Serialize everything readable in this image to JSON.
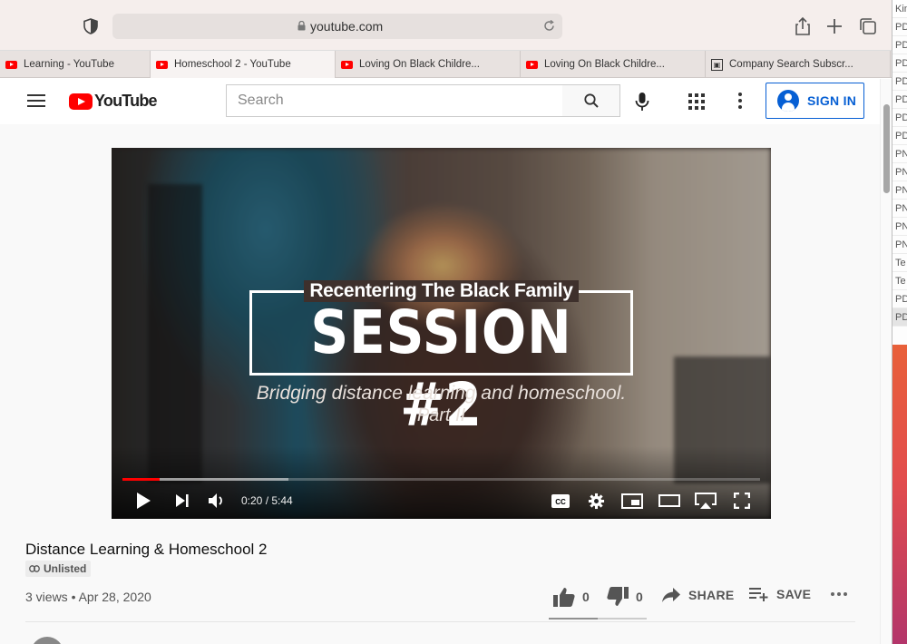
{
  "browser": {
    "url": "youtube.com",
    "tabs": [
      {
        "label": "Learning - YouTube",
        "favicon": "youtube-icon",
        "active": false
      },
      {
        "label": "Homeschool 2 - YouTube",
        "favicon": "youtube-icon",
        "active": true
      },
      {
        "label": "Loving On Black Childre...",
        "favicon": "youtube-icon",
        "active": false
      },
      {
        "label": "Loving On Black Childre...",
        "favicon": "youtube-icon",
        "active": false
      },
      {
        "label": "Company Search Subscr...",
        "favicon": "company-search-icon",
        "active": false
      }
    ]
  },
  "background_window": {
    "rows": [
      "Kin",
      "PD",
      "PD",
      "PD",
      "PD",
      "PD",
      "PD",
      "PD",
      "PN",
      "PN",
      "PN",
      "PN",
      "PN",
      "PN",
      "Te",
      "Te",
      "PD",
      "PD"
    ]
  },
  "youtube": {
    "logo_text": "YouTube",
    "search_placeholder": "Search",
    "sign_in_label": "SIGN IN"
  },
  "video": {
    "overlay_title": "Recentering The Black Family",
    "overlay_session": "SESSION #2",
    "overlay_subtitle": "Bridging distance learning and homeschool.",
    "overlay_part": "Part II",
    "time_display": "0:20 / 5:44",
    "played_fraction": 0.058,
    "buffered_fraction": 0.26
  },
  "metadata": {
    "title": "Distance Learning & Homeschool 2",
    "visibility_badge": "Unlisted",
    "views_date": "3 views • Apr 28, 2020",
    "like_count": "0",
    "dislike_count": "0",
    "share_label": "SHARE",
    "save_label": "SAVE"
  },
  "colors": {
    "brand_red": "#ff0000",
    "sign_in_blue": "#065fd4"
  }
}
